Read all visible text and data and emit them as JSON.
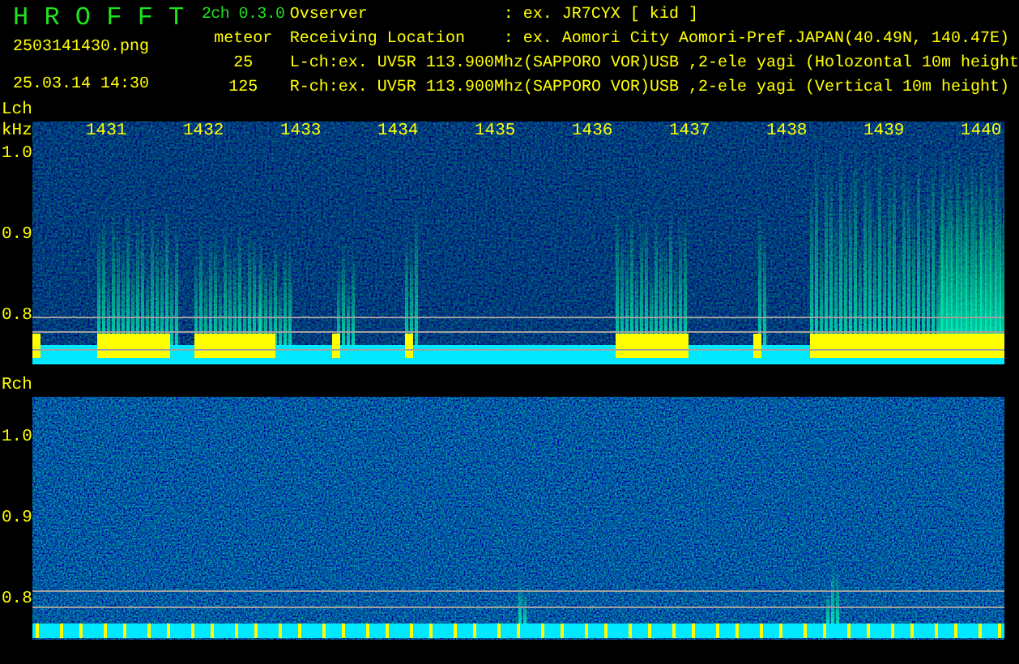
{
  "header": {
    "title": "H R O F F T",
    "version": "2ch 0.3.0",
    "filename": "2503141430.png",
    "timestamp": "25.03.14 14:30",
    "mode": "meteor",
    "count_1": "25",
    "count_2": "125"
  },
  "info": [
    {
      "label": "Ovserver",
      "value": ": ex. JR7CYX [ kid ]"
    },
    {
      "label": "Receiving Location",
      "value": ": ex. Aomori City Aomori-Pref.JAPAN(40.49N, 140.47E)"
    }
  ],
  "channels": [
    "L-ch:ex. UV5R 113.900Mhz(SAPPORO VOR)USB ,2-ele yagi (Holozontal 10m height",
    "R-ch:ex. UV5R 113.900Mhz(SAPPORO VOR)USB ,2-ele yagi (Vertical 10m height)"
  ],
  "panels": [
    {
      "label": "Lch",
      "unit": "kHz",
      "yticks": [
        "1.0",
        "0.9",
        "0.8"
      ],
      "minute_labels": [
        "1431",
        "1432",
        "1433",
        "1434",
        "1435",
        "1436",
        "1437",
        "1438",
        "1439",
        "1440"
      ]
    },
    {
      "label": "Rch",
      "yticks": [
        "1.0",
        "0.9",
        "0.8"
      ]
    }
  ]
}
